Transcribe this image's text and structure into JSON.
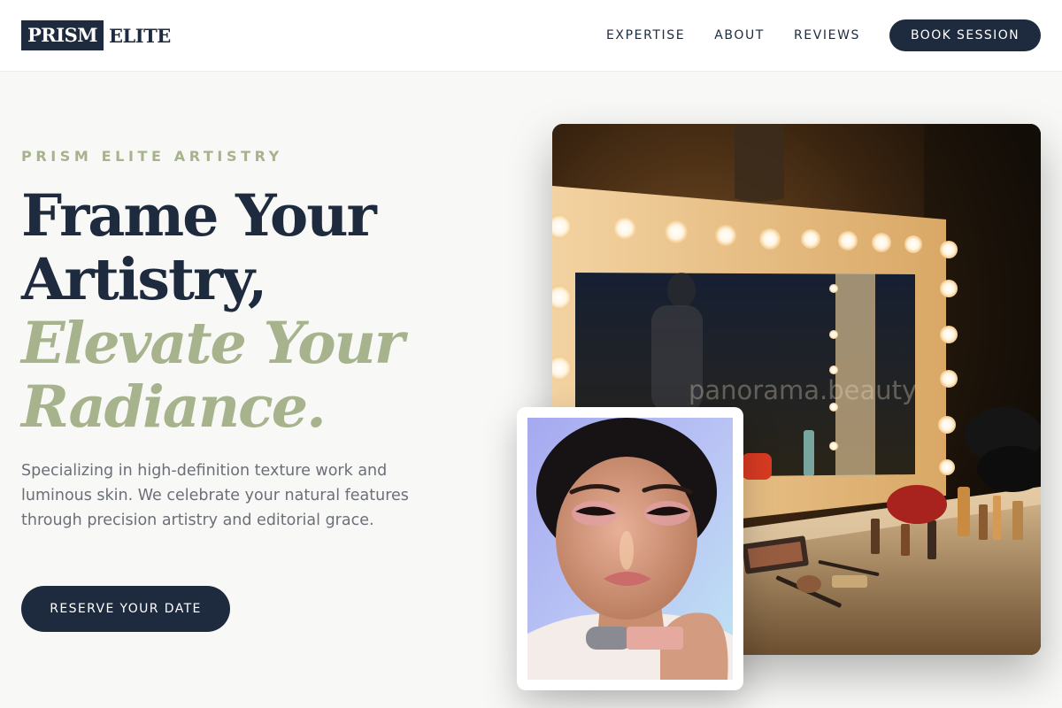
{
  "brand": {
    "mark": "PRISM",
    "name": "ELITE"
  },
  "nav": {
    "links": [
      "EXPERTISE",
      "ABOUT",
      "REVIEWS"
    ],
    "cta": "BOOK SESSION"
  },
  "hero": {
    "eyebrow": "PRISM ELITE ARTISTRY",
    "headline_lines": [
      "Frame Your",
      "Artistry,"
    ],
    "accent_lines": [
      "Elevate Your",
      "Radiance."
    ],
    "description": "Specializing in high-definition texture work and luminous skin. We celebrate your natural features through precision artistry and editorial grace.",
    "cta": "RESERVE YOUR DATE"
  },
  "gallery": {
    "watermark": "panorama.beauty"
  },
  "colors": {
    "navy": "#1e2a3e",
    "sage": "#a6b38c",
    "background": "#f8f8f6",
    "body_text": "#6b6f78"
  }
}
